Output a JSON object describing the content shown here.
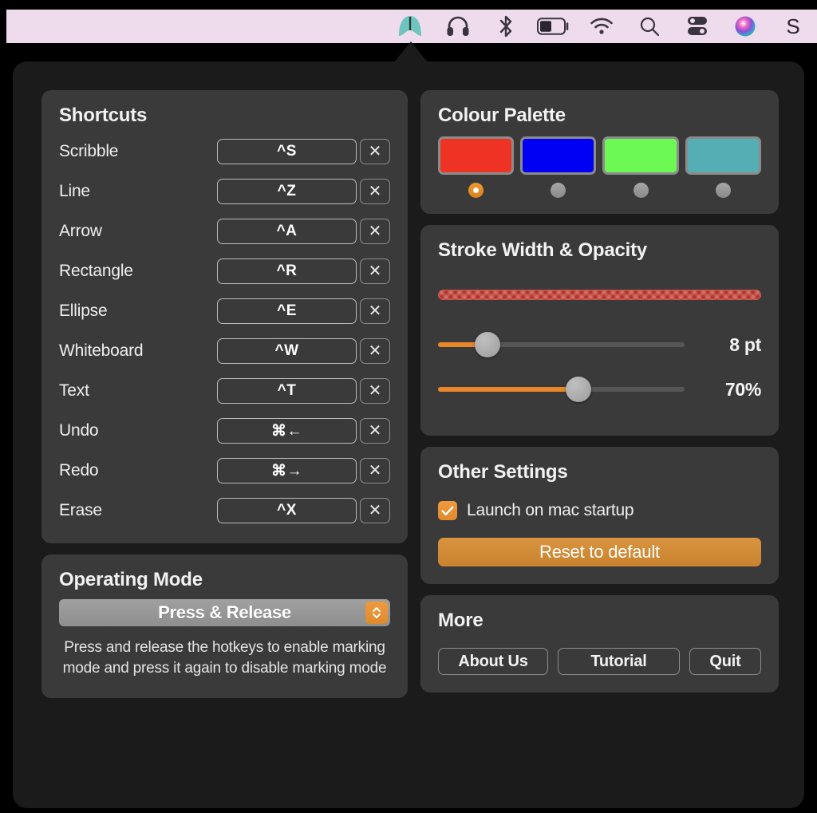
{
  "menubar": {
    "background": "#eedcec",
    "icons": [
      {
        "name": "presentify-app-icon",
        "label": "Presentify",
        "color": "#6ec5c0"
      },
      {
        "name": "headphones-icon",
        "label": "Headphones"
      },
      {
        "name": "bluetooth-icon",
        "label": "Bluetooth"
      },
      {
        "name": "battery-icon",
        "label": "Battery"
      },
      {
        "name": "wifi-icon",
        "label": "Wi-Fi"
      },
      {
        "name": "search-icon",
        "label": "Spotlight Search"
      },
      {
        "name": "control-center-icon",
        "label": "Control Center"
      },
      {
        "name": "siri-icon",
        "label": "Siri"
      },
      {
        "name": "user-menu-icon",
        "label": "S"
      }
    ],
    "trailing_letter": "S"
  },
  "shortcuts": {
    "title": "Shortcuts",
    "clear_glyph": "✕",
    "rows": [
      {
        "label": "Scribble",
        "key": "^S"
      },
      {
        "label": "Line",
        "key": "^Z"
      },
      {
        "label": "Arrow",
        "key": "^A"
      },
      {
        "label": "Rectangle",
        "key": "^R"
      },
      {
        "label": "Ellipse",
        "key": "^E"
      },
      {
        "label": "Whiteboard",
        "key": "^W"
      },
      {
        "label": "Text",
        "key": "^T"
      },
      {
        "label": "Undo",
        "key": "⌘←"
      },
      {
        "label": "Redo",
        "key": "⌘→"
      },
      {
        "label": "Erase",
        "key": "^X"
      }
    ]
  },
  "operating_mode": {
    "title": "Operating Mode",
    "selected": "Press & Release",
    "options": [
      "Press & Release"
    ],
    "description": "Press and release the hotkeys to enable marking mode and press it again to disable marking mode"
  },
  "colour_palette": {
    "title": "Colour Palette",
    "selected_index": 0,
    "accent": "#e8872a",
    "swatches": [
      {
        "name": "swatch-red",
        "color": "#ee3224",
        "selected": true
      },
      {
        "name": "swatch-blue",
        "color": "#0000f5",
        "selected": false
      },
      {
        "name": "swatch-green",
        "color": "#6df953",
        "selected": false
      },
      {
        "name": "swatch-teal",
        "color": "#55aeb4",
        "selected": false
      }
    ]
  },
  "stroke": {
    "title": "Stroke Width & Opacity",
    "preview_color": "#ee3224",
    "width": {
      "value_label": "8 pt",
      "percent": 20
    },
    "opacity": {
      "value_label": "70%",
      "percent": 57
    }
  },
  "other_settings": {
    "title": "Other Settings",
    "launch_label": "Launch on mac startup",
    "launch_checked": true,
    "reset_label": "Reset to default",
    "reset_color": "#d0892f"
  },
  "more": {
    "title": "More",
    "buttons": [
      {
        "name": "about-us-button",
        "label": "About Us"
      },
      {
        "name": "tutorial-button",
        "label": "Tutorial"
      },
      {
        "name": "quit-button",
        "label": "Quit"
      }
    ]
  }
}
